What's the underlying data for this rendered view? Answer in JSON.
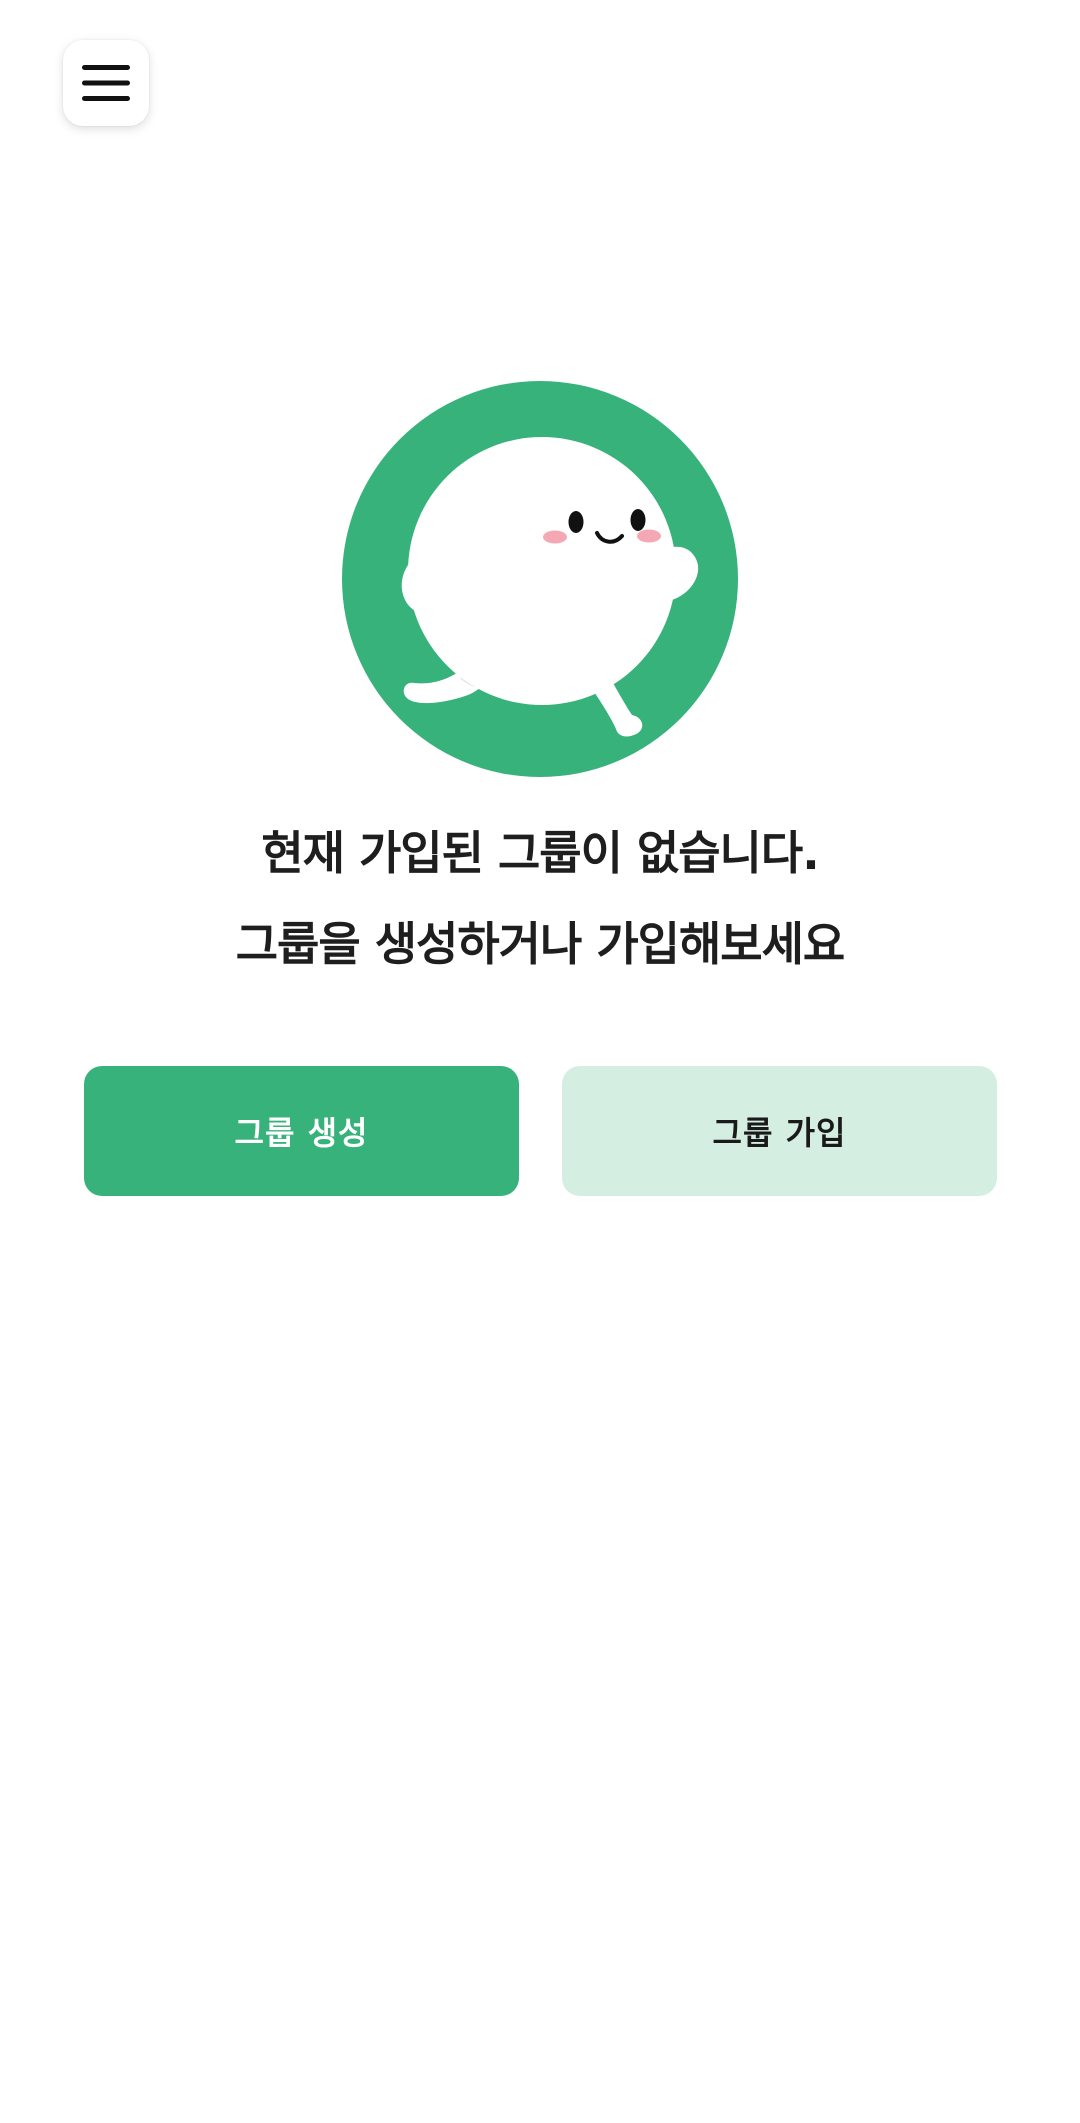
{
  "header": {
    "menu_icon": "hamburger-menu-icon"
  },
  "empty_state": {
    "illustration": "running-mascot-illustration",
    "line1": "현재 가입된 그룹이 없습니다.",
    "line2": "그룹을 생성하거나 가입해보세요"
  },
  "actions": {
    "create_label": "그룹 생성",
    "join_label": "그룹 가입"
  },
  "colors": {
    "primary": "#37b27b",
    "primary_light": "#d4efe2",
    "text": "#1e1e1e"
  }
}
